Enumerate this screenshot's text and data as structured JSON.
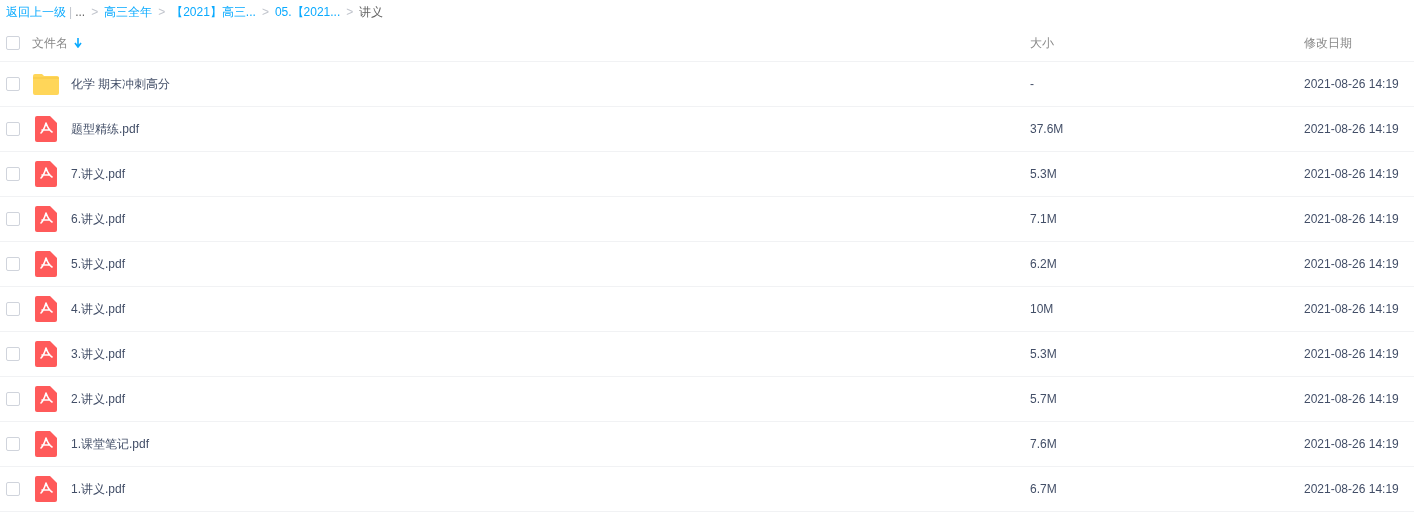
{
  "breadcrumb": [
    {
      "kind": "link",
      "text": "返回上一级"
    },
    {
      "kind": "divider",
      "text": "|"
    },
    {
      "kind": "text",
      "text": "..."
    },
    {
      "kind": "separator",
      "text": ">"
    },
    {
      "kind": "link",
      "text": "高三全年"
    },
    {
      "kind": "separator",
      "text": ">"
    },
    {
      "kind": "link",
      "text": "【2021】高三..."
    },
    {
      "kind": "separator",
      "text": ">"
    },
    {
      "kind": "link",
      "text": "05.【2021..."
    },
    {
      "kind": "separator",
      "text": ">"
    },
    {
      "kind": "text",
      "text": "讲义"
    }
  ],
  "table": {
    "select_all": {
      "checked": false
    },
    "columns": [
      {
        "label": "文件名",
        "sorted": true
      },
      {
        "label": "大小",
        "sorted": false
      },
      {
        "label": "修改日期",
        "sorted": false
      }
    ],
    "rows": [
      {
        "kind": "folder",
        "checked": false,
        "name": "化学 期末冲刺高分",
        "size": "-",
        "date": "2021-08-26 14:19"
      },
      {
        "kind": "pdf",
        "checked": false,
        "name": "题型精练.pdf",
        "size": "37.6M",
        "date": "2021-08-26 14:19"
      },
      {
        "kind": "pdf",
        "checked": false,
        "name": "7.讲义.pdf",
        "size": "5.3M",
        "date": "2021-08-26 14:19"
      },
      {
        "kind": "pdf",
        "checked": false,
        "name": "6.讲义.pdf",
        "size": "7.1M",
        "date": "2021-08-26 14:19"
      },
      {
        "kind": "pdf",
        "checked": false,
        "name": "5.讲义.pdf",
        "size": "6.2M",
        "date": "2021-08-26 14:19"
      },
      {
        "kind": "pdf",
        "checked": false,
        "name": "4.讲义.pdf",
        "size": "10M",
        "date": "2021-08-26 14:19"
      },
      {
        "kind": "pdf",
        "checked": false,
        "name": "3.讲义.pdf",
        "size": "5.3M",
        "date": "2021-08-26 14:19"
      },
      {
        "kind": "pdf",
        "checked": false,
        "name": "2.讲义.pdf",
        "size": "5.7M",
        "date": "2021-08-26 14:19"
      },
      {
        "kind": "pdf",
        "checked": false,
        "name": "1.课堂笔记.pdf",
        "size": "7.6M",
        "date": "2021-08-26 14:19"
      },
      {
        "kind": "pdf",
        "checked": false,
        "name": "1.讲义.pdf",
        "size": "6.7M",
        "date": "2021-08-26 14:19"
      }
    ]
  }
}
